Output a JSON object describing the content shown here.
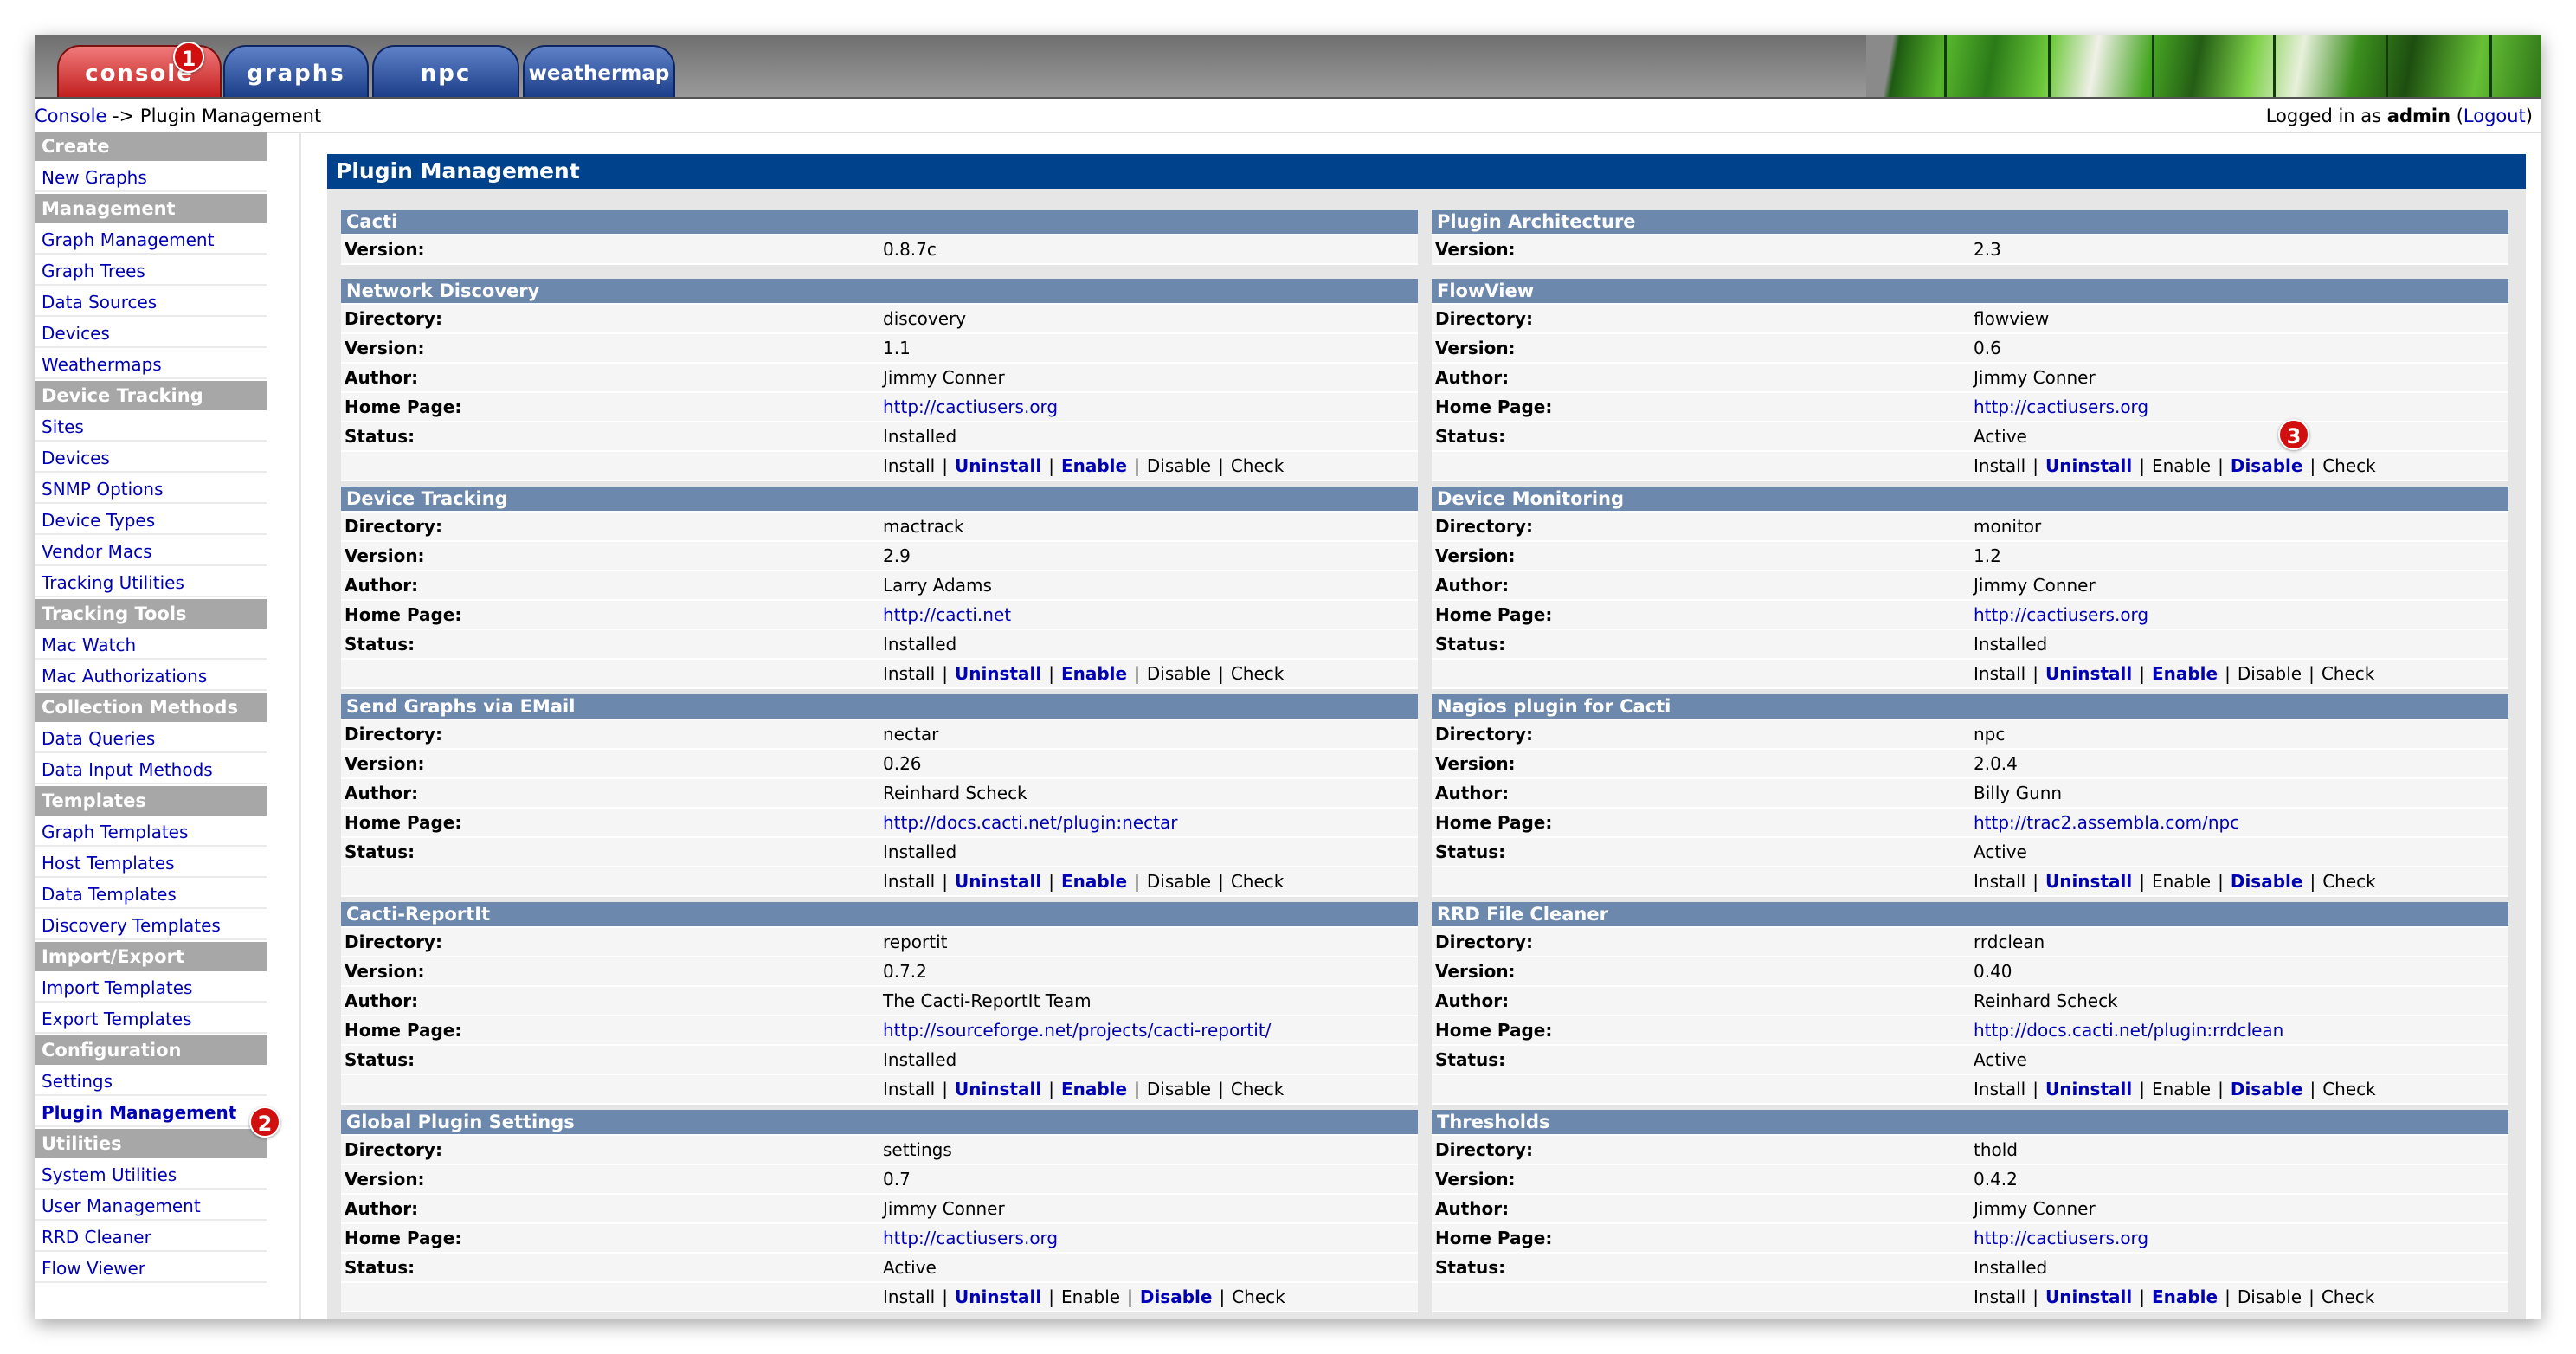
{
  "tabs": [
    {
      "label": "console"
    },
    {
      "label": "graphs"
    },
    {
      "label": "npc"
    },
    {
      "label": "weathermap"
    }
  ],
  "breadcrumb": {
    "root": "Console",
    "sep": " -> ",
    "current": "Plugin Management"
  },
  "login": {
    "prefix": "Logged in as ",
    "user": "admin",
    "open": " (",
    "logout": "Logout",
    "close": ")"
  },
  "sidebar": [
    {
      "type": "header",
      "label": "Create"
    },
    {
      "type": "link",
      "label": "New Graphs"
    },
    {
      "type": "header",
      "label": "Management"
    },
    {
      "type": "link",
      "label": "Graph Management"
    },
    {
      "type": "link",
      "label": "Graph Trees"
    },
    {
      "type": "link",
      "label": "Data Sources"
    },
    {
      "type": "link",
      "label": "Devices"
    },
    {
      "type": "link",
      "label": "Weathermaps"
    },
    {
      "type": "header",
      "label": "Device Tracking"
    },
    {
      "type": "link",
      "label": "Sites"
    },
    {
      "type": "link",
      "label": "Devices"
    },
    {
      "type": "link",
      "label": "SNMP Options"
    },
    {
      "type": "link",
      "label": "Device Types"
    },
    {
      "type": "link",
      "label": "Vendor Macs"
    },
    {
      "type": "link",
      "label": "Tracking Utilities"
    },
    {
      "type": "header",
      "label": "Tracking Tools"
    },
    {
      "type": "link",
      "label": "Mac Watch"
    },
    {
      "type": "link",
      "label": "Mac Authorizations"
    },
    {
      "type": "header",
      "label": "Collection Methods"
    },
    {
      "type": "link",
      "label": "Data Queries"
    },
    {
      "type": "link",
      "label": "Data Input Methods"
    },
    {
      "type": "header",
      "label": "Templates"
    },
    {
      "type": "link",
      "label": "Graph Templates"
    },
    {
      "type": "link",
      "label": "Host Templates"
    },
    {
      "type": "link",
      "label": "Data Templates"
    },
    {
      "type": "link",
      "label": "Discovery Templates"
    },
    {
      "type": "header",
      "label": "Import/Export"
    },
    {
      "type": "link",
      "label": "Import Templates"
    },
    {
      "type": "link",
      "label": "Export Templates"
    },
    {
      "type": "header",
      "label": "Configuration"
    },
    {
      "type": "link",
      "label": "Settings"
    },
    {
      "type": "link",
      "label": "Plugin Management",
      "current": true
    },
    {
      "type": "header",
      "label": "Utilities"
    },
    {
      "type": "link",
      "label": "System Utilities"
    },
    {
      "type": "link",
      "label": "User Management"
    },
    {
      "type": "link",
      "label": "RRD Cleaner"
    },
    {
      "type": "link",
      "label": "Flow Viewer"
    }
  ],
  "panel_title": "Plugin Management",
  "labels": {
    "version": "Version:",
    "directory": "Directory:",
    "author": "Author:",
    "homepage": "Home Page:",
    "status": "Status:"
  },
  "action_labels": [
    "Install",
    "Uninstall",
    "Enable",
    "Disable",
    "Check"
  ],
  "summary": [
    {
      "title": "Cacti",
      "version": "0.8.7c"
    },
    {
      "title": "Plugin Architecture",
      "version": "2.3"
    }
  ],
  "plugins": [
    {
      "title": "Network Discovery",
      "directory": "discovery",
      "version": "1.1",
      "author": "Jimmy Conner",
      "homepage": "http://cactiusers.org",
      "status": "Installed",
      "actions": [
        false,
        true,
        true,
        false,
        false
      ]
    },
    {
      "title": "FlowView",
      "directory": "flowview",
      "version": "0.6",
      "author": "Jimmy Conner",
      "homepage": "http://cactiusers.org",
      "status": "Active",
      "actions": [
        false,
        true,
        false,
        true,
        false
      ]
    },
    {
      "title": "Device Tracking",
      "directory": "mactrack",
      "version": "2.9",
      "author": "Larry Adams",
      "homepage": "http://cacti.net",
      "status": "Installed",
      "actions": [
        false,
        true,
        true,
        false,
        false
      ]
    },
    {
      "title": "Device Monitoring",
      "directory": "monitor",
      "version": "1.2",
      "author": "Jimmy Conner",
      "homepage": "http://cactiusers.org",
      "status": "Installed",
      "actions": [
        false,
        true,
        true,
        false,
        false
      ]
    },
    {
      "title": "Send Graphs via EMail",
      "directory": "nectar",
      "version": "0.26",
      "author": "Reinhard Scheck",
      "homepage": "http://docs.cacti.net/plugin:nectar",
      "status": "Installed",
      "actions": [
        false,
        true,
        true,
        false,
        false
      ]
    },
    {
      "title": "Nagios plugin for Cacti",
      "directory": "npc",
      "version": "2.0.4",
      "author": "Billy Gunn",
      "homepage": "http://trac2.assembla.com/npc",
      "status": "Active",
      "actions": [
        false,
        true,
        false,
        true,
        false
      ]
    },
    {
      "title": "Cacti-ReportIt",
      "directory": "reportit",
      "version": "0.7.2",
      "author": "The Cacti-ReportIt Team",
      "homepage": "http://sourceforge.net/projects/cacti-reportit/",
      "status": "Installed",
      "actions": [
        false,
        true,
        true,
        false,
        false
      ]
    },
    {
      "title": "RRD File Cleaner",
      "directory": "rrdclean",
      "version": "0.40",
      "author": "Reinhard Scheck",
      "homepage": "http://docs.cacti.net/plugin:rrdclean",
      "status": "Active",
      "actions": [
        false,
        true,
        false,
        true,
        false
      ]
    },
    {
      "title": "Global Plugin Settings",
      "directory": "settings",
      "version": "0.7",
      "author": "Jimmy Conner",
      "homepage": "http://cactiusers.org",
      "status": "Active",
      "actions": [
        false,
        true,
        false,
        true,
        false
      ]
    },
    {
      "title": "Thresholds",
      "directory": "thold",
      "version": "0.4.2",
      "author": "Jimmy Conner",
      "homepage": "http://cactiusers.org",
      "status": "Installed",
      "actions": [
        false,
        true,
        true,
        false,
        false
      ]
    }
  ],
  "badges": [
    "1",
    "2",
    "3"
  ],
  "colors": {
    "link": "#0000b4",
    "panel_header": "#00438c",
    "card_header": "#6d88ad",
    "sidebar_header": "#a7a7a7",
    "badge": "#d10f0f"
  }
}
